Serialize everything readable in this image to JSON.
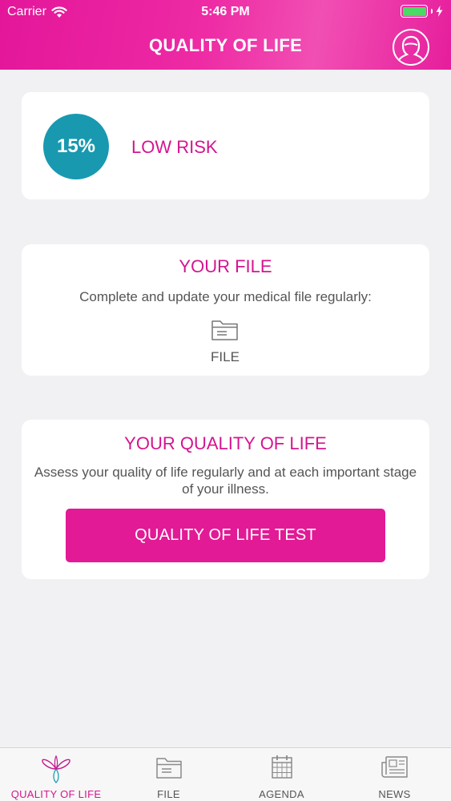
{
  "status_bar": {
    "carrier": "Carrier",
    "time": "5:46 PM",
    "battery_color": "#4cd964"
  },
  "header": {
    "title": "QUALITY OF LIFE",
    "profile_icon": "user-avatar-icon",
    "background_color": "#e8199d"
  },
  "risk_card": {
    "percentage": "15%",
    "label": "LOW RISK",
    "circle_color": "#1899b0"
  },
  "file_card": {
    "title": "YOUR FILE",
    "description": "Complete and update your medical file regularly:",
    "link_label": "FILE",
    "link_icon": "folder-icon"
  },
  "qol_card": {
    "title": "YOUR QUALITY OF LIFE",
    "description": "Assess your quality of life regularly and at each important stage of your illness.",
    "button_label": "QUALITY OF LIFE TEST",
    "button_color": "#e21a95"
  },
  "tab_bar": {
    "items": [
      {
        "label": "QUALITY OF LIFE",
        "icon": "ribbon-flower-icon",
        "active": true
      },
      {
        "label": "FILE",
        "icon": "folder-icon",
        "active": false
      },
      {
        "label": "AGENDA",
        "icon": "calendar-icon",
        "active": false
      },
      {
        "label": "NEWS",
        "icon": "newspaper-icon",
        "active": false
      }
    ]
  },
  "colors": {
    "accent": "#d41590",
    "background": "#f1f1f3"
  }
}
